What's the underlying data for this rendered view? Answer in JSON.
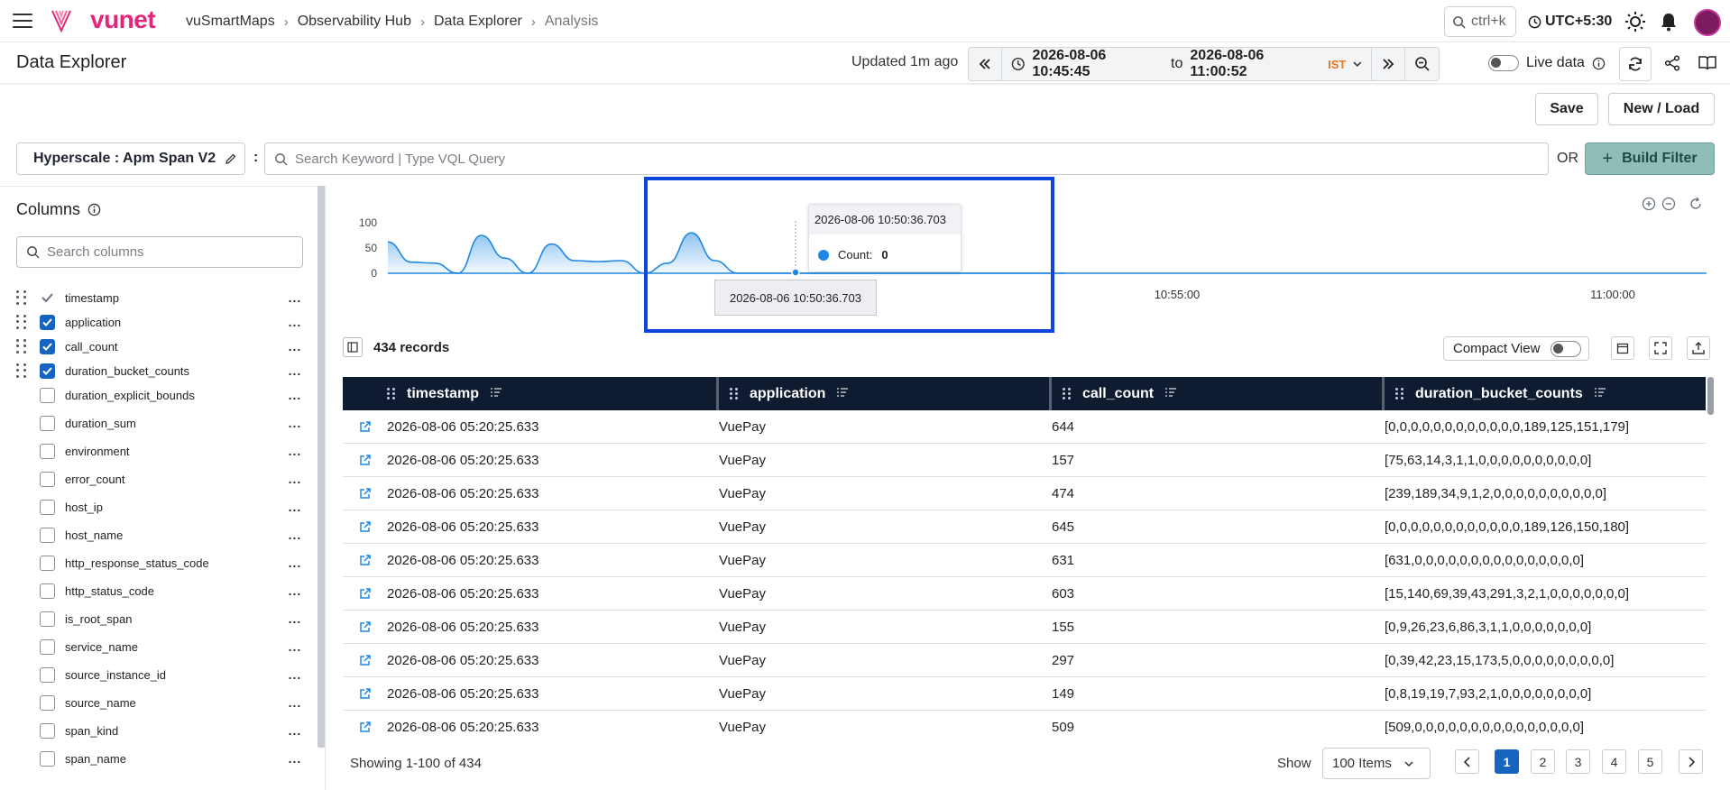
{
  "nav": {
    "logo_text": "vunet",
    "breadcrumbs": [
      "vuSmartMaps",
      "Observability Hub",
      "Data Explorer",
      "Analysis"
    ],
    "search_shortcut": "ctrl+k",
    "timezone": "UTC+5:30"
  },
  "header": {
    "title": "Data Explorer",
    "updated": "Updated 1m ago",
    "time_from": "2026-08-06 10:45:45",
    "time_to_word": "to",
    "time_to": "2026-08-06 11:00:52",
    "tz_badge": "IST",
    "live_label": "Live data"
  },
  "actions": {
    "save": "Save",
    "new_load": "New / Load"
  },
  "query": {
    "datasource": "Hyperscale : Apm Span V2",
    "colon": ":",
    "placeholder": "Search Keyword | Type VQL Query",
    "or": "OR",
    "build_filter": "Build Filter"
  },
  "sidebar": {
    "title": "Columns",
    "search_placeholder": "Search columns",
    "columns": [
      {
        "name": "timestamp",
        "checked": "grey",
        "draggable": true
      },
      {
        "name": "application",
        "checked": "on",
        "draggable": true
      },
      {
        "name": "call_count",
        "checked": "on",
        "draggable": true
      },
      {
        "name": "duration_bucket_counts",
        "checked": "on",
        "draggable": true
      },
      {
        "name": "duration_explicit_bounds",
        "checked": "off",
        "draggable": false
      },
      {
        "name": "duration_sum",
        "checked": "off",
        "draggable": false
      },
      {
        "name": "environment",
        "checked": "off",
        "draggable": false
      },
      {
        "name": "error_count",
        "checked": "off",
        "draggable": false
      },
      {
        "name": "host_ip",
        "checked": "off",
        "draggable": false
      },
      {
        "name": "host_name",
        "checked": "off",
        "draggable": false
      },
      {
        "name": "http_response_status_code",
        "checked": "off",
        "draggable": false
      },
      {
        "name": "http_status_code",
        "checked": "off",
        "draggable": false
      },
      {
        "name": "is_root_span",
        "checked": "off",
        "draggable": false
      },
      {
        "name": "service_name",
        "checked": "off",
        "draggable": false
      },
      {
        "name": "source_instance_id",
        "checked": "off",
        "draggable": false
      },
      {
        "name": "source_name",
        "checked": "off",
        "draggable": false
      },
      {
        "name": "span_kind",
        "checked": "off",
        "draggable": false
      },
      {
        "name": "span_name",
        "checked": "off",
        "draggable": false
      }
    ],
    "more_label": "..."
  },
  "chart": {
    "tooltip_title": "2026-08-06 10:50:36.703",
    "tooltip_series": "Count:",
    "tooltip_value": "0",
    "x_tooltip": "2026-08-06 10:50:36.703",
    "colors": {
      "line": "#1e88e5",
      "highlight": "#0d47d9"
    }
  },
  "chart_data": {
    "type": "area",
    "ylim": [
      0,
      100
    ],
    "y_ticks": [
      "100",
      "50",
      "0"
    ],
    "x_ticks": [
      "10:55:00",
      "11:00:00"
    ],
    "series": [
      {
        "values": [
          62,
          22,
          20,
          0,
          75,
          30,
          0,
          58,
          25,
          23,
          25,
          0,
          20,
          80,
          25,
          0,
          0,
          0,
          0,
          0,
          0,
          0,
          0,
          0,
          0,
          0,
          0,
          0,
          0,
          0
        ]
      }
    ]
  },
  "table": {
    "records": "434 records",
    "compact_label": "Compact View",
    "headers": [
      "timestamp",
      "application",
      "call_count",
      "duration_bucket_counts"
    ],
    "rows": [
      [
        "2026-08-06 05:20:25.633",
        "VuePay",
        "644",
        "[0,0,0,0,0,0,0,0,0,0,0,0,189,125,151,179]"
      ],
      [
        "2026-08-06 05:20:25.633",
        "VuePay",
        "157",
        "[75,63,14,3,1,1,0,0,0,0,0,0,0,0,0,0]"
      ],
      [
        "2026-08-06 05:20:25.633",
        "VuePay",
        "474",
        "[239,189,34,9,1,2,0,0,0,0,0,0,0,0,0,0]"
      ],
      [
        "2026-08-06 05:20:25.633",
        "VuePay",
        "645",
        "[0,0,0,0,0,0,0,0,0,0,0,0,189,126,150,180]"
      ],
      [
        "2026-08-06 05:20:25.633",
        "VuePay",
        "631",
        "[631,0,0,0,0,0,0,0,0,0,0,0,0,0,0,0]"
      ],
      [
        "2026-08-06 05:20:25.633",
        "VuePay",
        "603",
        "[15,140,69,39,43,291,3,2,1,0,0,0,0,0,0,0]"
      ],
      [
        "2026-08-06 05:20:25.633",
        "VuePay",
        "155",
        "[0,9,26,23,6,86,3,1,1,0,0,0,0,0,0,0]"
      ],
      [
        "2026-08-06 05:20:25.633",
        "VuePay",
        "297",
        "[0,39,42,23,15,173,5,0,0,0,0,0,0,0,0,0]"
      ],
      [
        "2026-08-06 05:20:25.633",
        "VuePay",
        "149",
        "[0,8,19,19,7,93,2,1,0,0,0,0,0,0,0,0]"
      ],
      [
        "2026-08-06 05:20:25.633",
        "VuePay",
        "509",
        "[509,0,0,0,0,0,0,0,0,0,0,0,0,0,0,0]"
      ]
    ],
    "showing": "Showing 1-100 of 434",
    "show_label": "Show",
    "items_per_page": "100 Items",
    "pages": [
      "1",
      "2",
      "3",
      "4",
      "5"
    ],
    "active_page": "1"
  }
}
